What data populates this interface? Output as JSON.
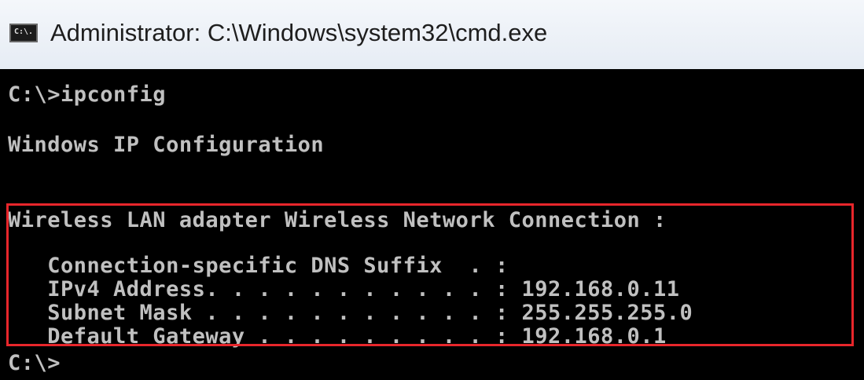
{
  "window": {
    "title": "Administrator: C:\\Windows\\system32\\cmd.exe",
    "icon": "cmd-console-icon",
    "icon_label": "C:\\."
  },
  "console": {
    "lines": [
      "C:\\>ipconfig",
      "Windows IP Configuration",
      "Wireless LAN adapter Wireless Network Connection :",
      "   Connection-specific DNS Suffix  . :",
      "   IPv4 Address. . . . . . . . . . . : 192.168.0.11",
      "   Subnet Mask . . . . . . . . . . . : 255.255.255.0",
      "   Default Gateway . . . . . . . . . : 192.168.0.1",
      "C:\\>"
    ]
  },
  "highlight": {
    "color": "#e8262b"
  },
  "colors": {
    "console_background": "#000000",
    "console_text": "#c0c0c0",
    "titlebar_background": "#eef2f8"
  }
}
